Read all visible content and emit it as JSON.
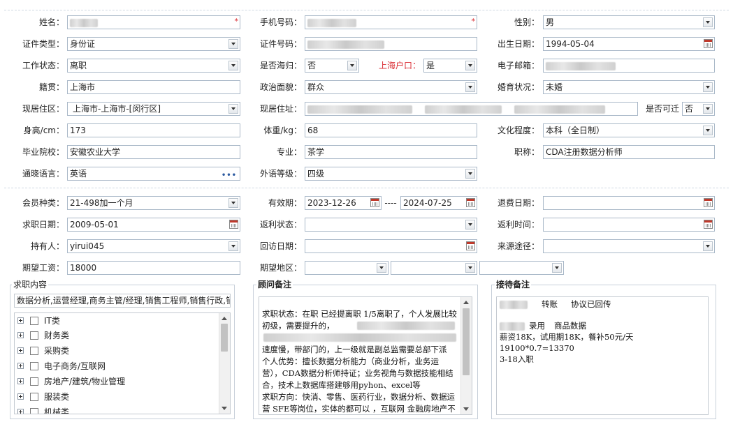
{
  "personal": {
    "name": {
      "label": "姓名：",
      "value": ""
    },
    "phone": {
      "label": "手机号码：",
      "value": ""
    },
    "gender": {
      "label": "性别：",
      "value": "男"
    },
    "id_type": {
      "label": "证件类型：",
      "value": "身份证"
    },
    "id_no": {
      "label": "证件号码：",
      "value": ""
    },
    "birth": {
      "label": "出生日期：",
      "value": "1994-05-04"
    },
    "work_status": {
      "label": "工作状态：",
      "value": "离职"
    },
    "overseas": {
      "label": "是否海归：",
      "value": "否"
    },
    "sh_hukou": {
      "label": "上海户口：",
      "value": "是"
    },
    "email": {
      "label": "电子邮箱：",
      "value": ""
    },
    "native": {
      "label": "籍贯：",
      "value": "上海市"
    },
    "political": {
      "label": "政治面貌：",
      "value": "群众"
    },
    "marital": {
      "label": "婚育状况：",
      "value": "未婚"
    },
    "residence_area": {
      "label": "现居住区：",
      "value": "上海市-上海市-[闵行区]"
    },
    "address": {
      "label": "现居住址：",
      "value": ""
    },
    "relocate": {
      "label": "是否可迁",
      "value": "否"
    },
    "height": {
      "label": "身高/cm：",
      "value": "173"
    },
    "weight": {
      "label": "体重/kg：",
      "value": "68"
    },
    "education": {
      "label": "文化程度：",
      "value": "本科（全日制）"
    },
    "school": {
      "label": "毕业院校：",
      "value": "安徽农业大学"
    },
    "major": {
      "label": "专业：",
      "value": "茶学"
    },
    "title": {
      "label": "职称：",
      "value": "CDA注册数据分析师"
    },
    "language": {
      "label": "通晓语言：",
      "value": "英语"
    },
    "foreign_level": {
      "label": "外语等级：",
      "value": "四级"
    }
  },
  "membership": {
    "member_type": {
      "label": "会员种类：",
      "value": "21-498加一个月"
    },
    "valid": {
      "label": "有效期：",
      "from": "2023-12-26",
      "sep": "----",
      "to": "2024-07-25"
    },
    "refund_date": {
      "label": "退费日期：",
      "value": ""
    },
    "job_date": {
      "label": "求职日期：",
      "value": "2009-05-01"
    },
    "rebate_status": {
      "label": "返利状态：",
      "value": ""
    },
    "rebate_time": {
      "label": "返利时间：",
      "value": ""
    },
    "holder": {
      "label": "持有人：",
      "value": "yirui045"
    },
    "revisit": {
      "label": "回访日期：",
      "value": ""
    },
    "source": {
      "label": "来源途径：",
      "value": ""
    },
    "salary": {
      "label": "期望工资：",
      "value": "18000"
    },
    "region": {
      "label": "期望地区：",
      "v1": "",
      "v2": "",
      "v3": ""
    }
  },
  "job_content": {
    "title": "求职内容",
    "summary": "数据分析,运营经理,商务主管/经理,销售工程师,销售行政,销",
    "categories": [
      "IT类",
      "财务类",
      "采购类",
      "电子商务/互联网",
      "房地产/建筑/物业管理",
      "服装类",
      "机械类"
    ]
  },
  "advisor_notes": {
    "title": "顾问备注",
    "text": "求职状态：在职 已经提离职 1/5离职了，个人发展比较初级，需要提升的，\n\n速度慢，带部门的，上一级就是副总监需要总部下派\n个人优势：擅长数据分析能力（商业分析，业务运营），CDA数据分析师持证；业务视角与数据技能相结合，技术上数据库搭建够用pyhon、excel等\n求职方向：快消、零售、医药行业，数据分析、数据运营 SFE等岗位，实体的都可以 ，互联网 金融房地产不考虑"
  },
  "reception_notes": {
    "title": "接待备注",
    "line1a": "转账",
    "line1b": "协议已回传",
    "line2a": "录用",
    "line2b": "商品数据",
    "line3": "薪资18K，试用期18K，餐补50元/天",
    "line4": "19100*0.7=13370",
    "line5": "3-18入职"
  },
  "colors": {
    "accent_red": "#d9282f",
    "border": "#a9b8c8"
  }
}
